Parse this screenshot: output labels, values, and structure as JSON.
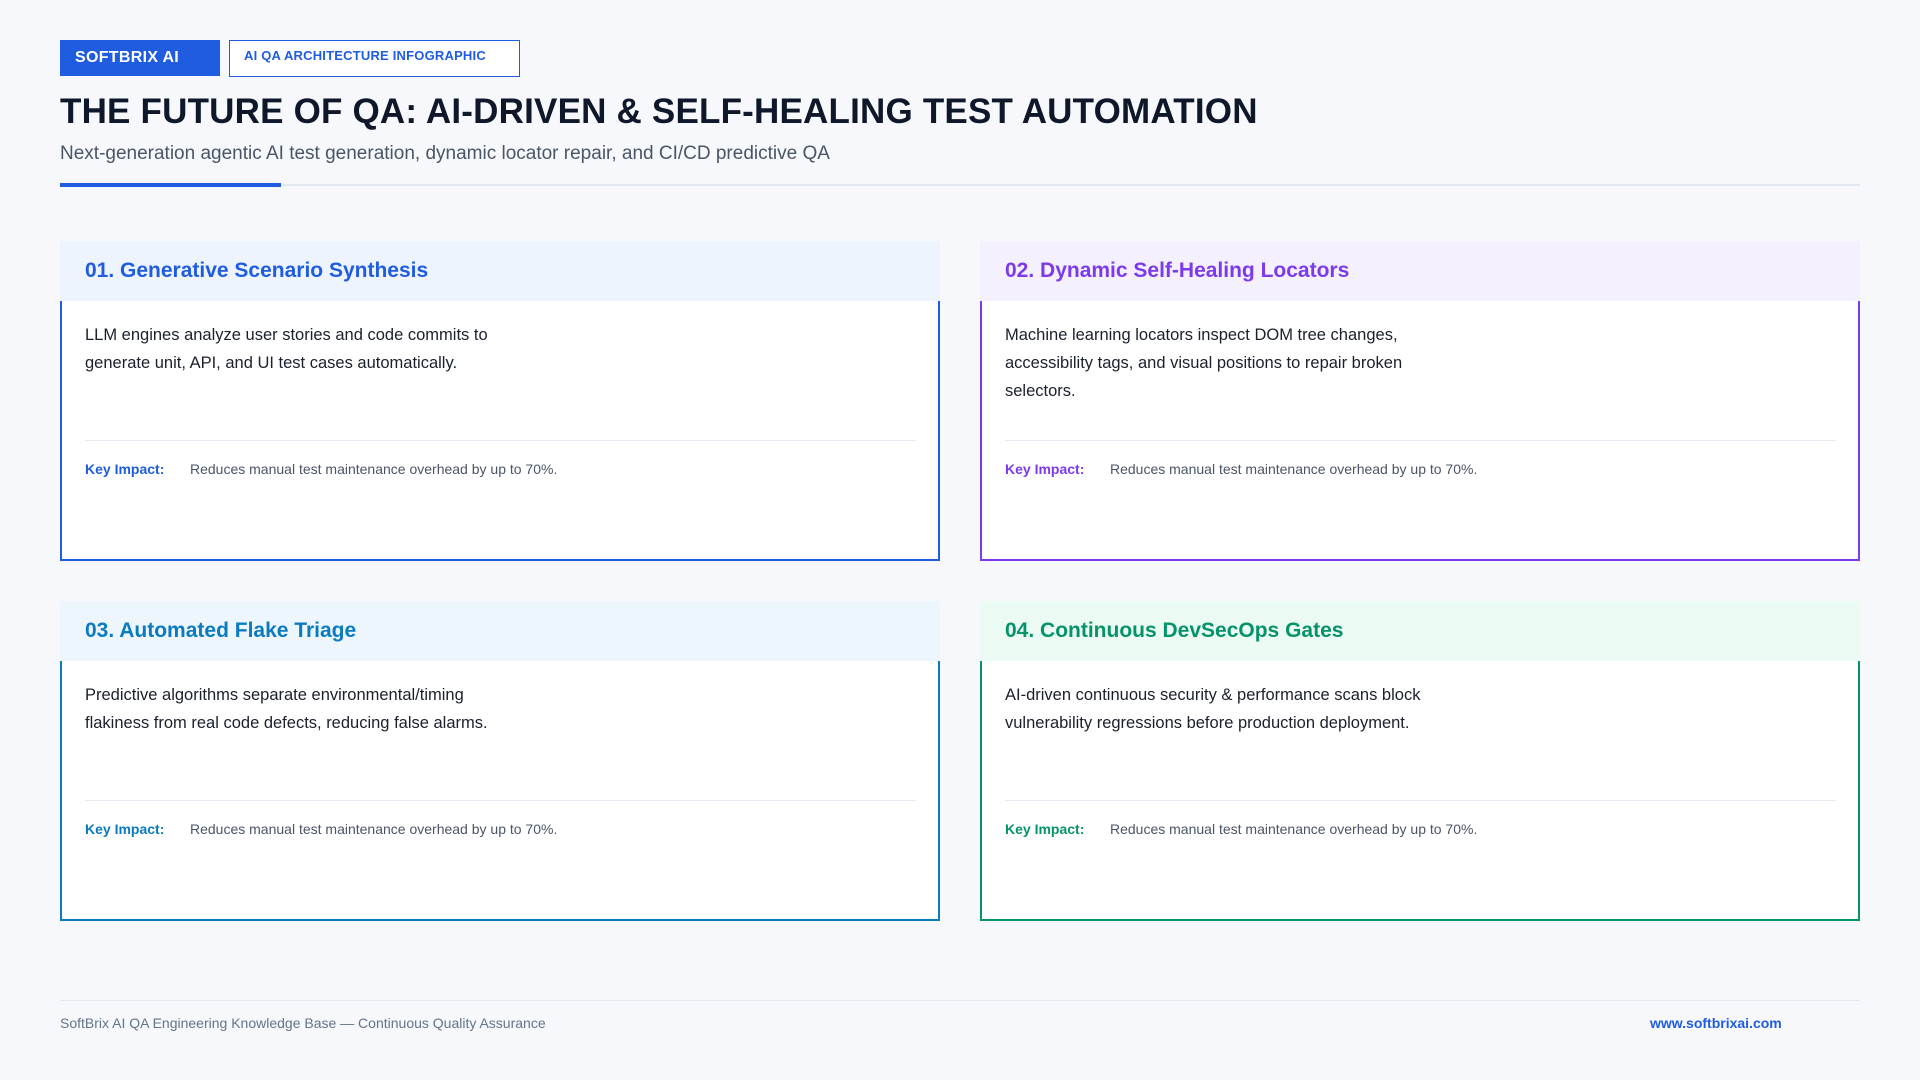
{
  "header": {
    "brand_badge": "SOFTBRIX AI",
    "category_badge": "AI QA ARCHITECTURE INFOGRAPHIC",
    "title": "THE FUTURE OF QA: AI-DRIVEN & SELF-HEALING TEST AUTOMATION",
    "subtitle": "Next-generation agentic AI test generation, dynamic locator repair, and CI/CD predictive QA"
  },
  "colors": {
    "brand": "#1f5ce0",
    "card_1": "#1f5ce0",
    "card_2": "#7c3aed",
    "card_3": "#0a7bbf",
    "card_4": "#05936a"
  },
  "cards": [
    {
      "title": "01. Generative Scenario Synthesis",
      "description": "LLM engines analyze user stories and code commits to generate unit, API, and UI test cases automatically.",
      "impact_label": "Key Impact:",
      "impact_text": "Reduces manual test maintenance overhead by up to 70%."
    },
    {
      "title": "02. Dynamic Self-Healing Locators",
      "description": "Machine learning locators inspect DOM tree changes, accessibility tags, and visual positions to repair broken selectors.",
      "impact_label": "Key Impact:",
      "impact_text": "Reduces manual test maintenance overhead by up to 70%."
    },
    {
      "title": "03. Automated Flake Triage",
      "description": "Predictive algorithms separate environmental/timing flakiness from real code defects, reducing false alarms.",
      "impact_label": "Key Impact:",
      "impact_text": "Reduces manual test maintenance overhead by up to 70%."
    },
    {
      "title": "04. Continuous DevSecOps Gates",
      "description": "AI-driven continuous security & performance scans block vulnerability regressions before production deployment.",
      "impact_label": "Key Impact:",
      "impact_text": "Reduces manual test maintenance overhead by up to 70%."
    }
  ],
  "footer": {
    "left_text": "SoftBrix AI QA Engineering Knowledge Base — Continuous Quality Assurance",
    "right_link": "www.softbrixai.com"
  }
}
